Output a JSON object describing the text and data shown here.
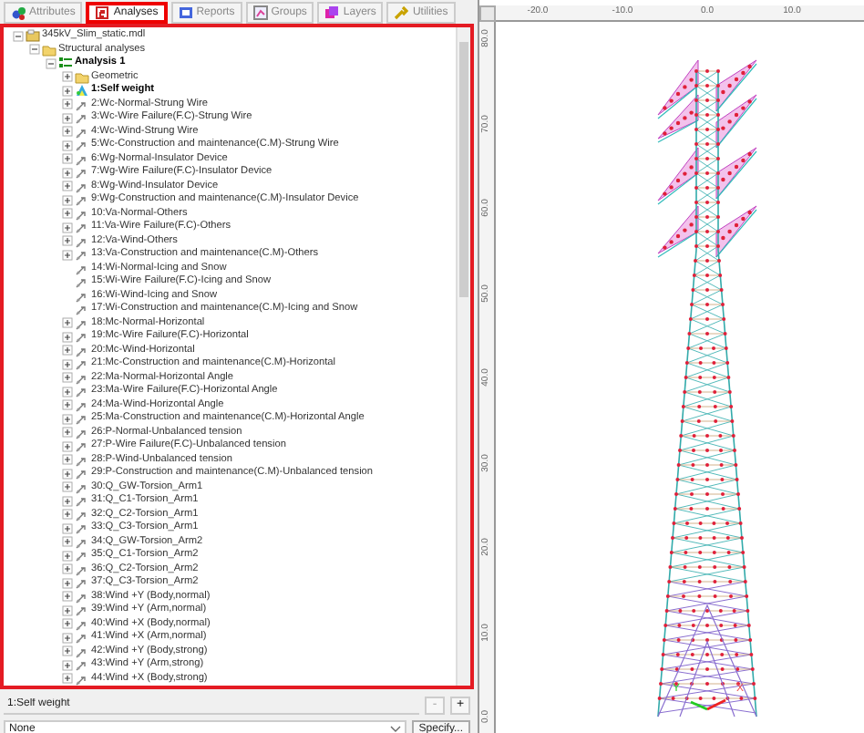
{
  "tabs": [
    {
      "label": "Attributes",
      "selected": false
    },
    {
      "label": "Analyses",
      "selected": true
    },
    {
      "label": "Reports",
      "selected": false
    },
    {
      "label": "Groups",
      "selected": false
    },
    {
      "label": "Layers",
      "selected": false
    },
    {
      "label": "Utilities",
      "selected": false
    }
  ],
  "tree": [
    {
      "label": "345kV_Slim_static.mdl",
      "kind": "file",
      "expandable": true,
      "expanded": true,
      "children": [
        {
          "label": "Structural analyses",
          "kind": "folder",
          "expandable": true,
          "expanded": true,
          "children": [
            {
              "label": "Analysis 1",
              "kind": "analysis",
              "expandable": true,
              "expanded": true,
              "children": [
                {
                  "label": "Geometric",
                  "kind": "folder",
                  "expandable": true,
                  "expanded": false
                },
                {
                  "label": "1:Self weight",
                  "kind": "active_load",
                  "expandable": true,
                  "expanded": false
                },
                {
                  "label": "2:Wc-Normal-Strung Wire",
                  "kind": "load",
                  "expandable": true,
                  "expanded": false
                },
                {
                  "label": "3:Wc-Wire Failure(F.C)-Strung Wire",
                  "kind": "load",
                  "expandable": true,
                  "expanded": false
                },
                {
                  "label": "4:Wc-Wind-Strung Wire",
                  "kind": "load",
                  "expandable": true,
                  "expanded": false
                },
                {
                  "label": "5:Wc-Construction and maintenance(C.M)-Strung Wire",
                  "kind": "load",
                  "expandable": true,
                  "expanded": false
                },
                {
                  "label": "6:Wg-Normal-Insulator Device",
                  "kind": "load",
                  "expandable": true,
                  "expanded": false
                },
                {
                  "label": "7:Wg-Wire Failure(F.C)-Insulator Device",
                  "kind": "load",
                  "expandable": true,
                  "expanded": false
                },
                {
                  "label": "8:Wg-Wind-Insulator Device",
                  "kind": "load",
                  "expandable": true,
                  "expanded": false
                },
                {
                  "label": "9:Wg-Construction and maintenance(C.M)-Insulator Device",
                  "kind": "load",
                  "expandable": true,
                  "expanded": false
                },
                {
                  "label": "10:Va-Normal-Others",
                  "kind": "load",
                  "expandable": true,
                  "expanded": false
                },
                {
                  "label": "11:Va-Wire Failure(F.C)-Others",
                  "kind": "load",
                  "expandable": true,
                  "expanded": false
                },
                {
                  "label": "12:Va-Wind-Others",
                  "kind": "load",
                  "expandable": true,
                  "expanded": false
                },
                {
                  "label": "13:Va-Construction and maintenance(C.M)-Others",
                  "kind": "load",
                  "expandable": true,
                  "expanded": false
                },
                {
                  "label": "14:Wi-Normal-Icing and Snow",
                  "kind": "load",
                  "expandable": false
                },
                {
                  "label": "15:Wi-Wire Failure(F.C)-Icing and Snow",
                  "kind": "load",
                  "expandable": false
                },
                {
                  "label": "16:Wi-Wind-Icing and Snow",
                  "kind": "load",
                  "expandable": false
                },
                {
                  "label": "17:Wi-Construction and maintenance(C.M)-Icing and Snow",
                  "kind": "load",
                  "expandable": false
                },
                {
                  "label": "18:Mc-Normal-Horizontal",
                  "kind": "load",
                  "expandable": true,
                  "expanded": false
                },
                {
                  "label": "19:Mc-Wire Failure(F.C)-Horizontal",
                  "kind": "load",
                  "expandable": true,
                  "expanded": false
                },
                {
                  "label": "20:Mc-Wind-Horizontal",
                  "kind": "load",
                  "expandable": true,
                  "expanded": false
                },
                {
                  "label": "21:Mc-Construction and maintenance(C.M)-Horizontal",
                  "kind": "load",
                  "expandable": true,
                  "expanded": false
                },
                {
                  "label": "22:Ma-Normal-Horizontal Angle",
                  "kind": "load",
                  "expandable": true,
                  "expanded": false
                },
                {
                  "label": "23:Ma-Wire Failure(F.C)-Horizontal Angle",
                  "kind": "load",
                  "expandable": true,
                  "expanded": false
                },
                {
                  "label": "24:Ma-Wind-Horizontal Angle",
                  "kind": "load",
                  "expandable": true,
                  "expanded": false
                },
                {
                  "label": "25:Ma-Construction and maintenance(C.M)-Horizontal Angle",
                  "kind": "load",
                  "expandable": true,
                  "expanded": false
                },
                {
                  "label": "26:P-Normal-Unbalanced tension",
                  "kind": "load",
                  "expandable": true,
                  "expanded": false
                },
                {
                  "label": "27:P-Wire Failure(F.C)-Unbalanced tension",
                  "kind": "load",
                  "expandable": true,
                  "expanded": false
                },
                {
                  "label": "28:P-Wind-Unbalanced tension",
                  "kind": "load",
                  "expandable": true,
                  "expanded": false
                },
                {
                  "label": "29:P-Construction and maintenance(C.M)-Unbalanced tension",
                  "kind": "load",
                  "expandable": true,
                  "expanded": false
                },
                {
                  "label": "30:Q_GW-Torsion_Arm1",
                  "kind": "load",
                  "expandable": true,
                  "expanded": false
                },
                {
                  "label": "31:Q_C1-Torsion_Arm1",
                  "kind": "load",
                  "expandable": true,
                  "expanded": false
                },
                {
                  "label": "32:Q_C2-Torsion_Arm1",
                  "kind": "load",
                  "expandable": true,
                  "expanded": false
                },
                {
                  "label": "33:Q_C3-Torsion_Arm1",
                  "kind": "load",
                  "expandable": true,
                  "expanded": false
                },
                {
                  "label": "34:Q_GW-Torsion_Arm2",
                  "kind": "load",
                  "expandable": true,
                  "expanded": false
                },
                {
                  "label": "35:Q_C1-Torsion_Arm2",
                  "kind": "load",
                  "expandable": true,
                  "expanded": false
                },
                {
                  "label": "36:Q_C2-Torsion_Arm2",
                  "kind": "load",
                  "expandable": true,
                  "expanded": false
                },
                {
                  "label": "37:Q_C3-Torsion_Arm2",
                  "kind": "load",
                  "expandable": true,
                  "expanded": false
                },
                {
                  "label": "38:Wind +Y (Body,normal)",
                  "kind": "load",
                  "expandable": true,
                  "expanded": false
                },
                {
                  "label": "39:Wind +Y (Arm,normal)",
                  "kind": "load",
                  "expandable": true,
                  "expanded": false
                },
                {
                  "label": "40:Wind +X (Body,normal)",
                  "kind": "load",
                  "expandable": true,
                  "expanded": false
                },
                {
                  "label": "41:Wind +X (Arm,normal)",
                  "kind": "load",
                  "expandable": true,
                  "expanded": false
                },
                {
                  "label": "42:Wind +Y (Body,strong)",
                  "kind": "load",
                  "expandable": true,
                  "expanded": false
                },
                {
                  "label": "43:Wind +Y (Arm,strong)",
                  "kind": "load",
                  "expandable": true,
                  "expanded": false
                },
                {
                  "label": "44:Wind +X (Body,strong)",
                  "kind": "load",
                  "expandable": true,
                  "expanded": false
                }
              ]
            }
          ]
        }
      ]
    }
  ],
  "current_case": {
    "value": "1:Self weight",
    "buttons": [
      {
        "label": "-",
        "disabled": true
      },
      {
        "label": "+",
        "disabled": false
      }
    ]
  },
  "filter": {
    "value": "None",
    "button": "Specify..."
  },
  "viewer": {
    "x_ruler": [
      "-20.0",
      "-10.0",
      "0.0",
      "10.0"
    ],
    "y_ruler": [
      "80.0",
      "70.0",
      "60.0",
      "50.0",
      "40.0",
      "30.0",
      "20.0",
      "10.0",
      "0.0"
    ],
    "axes": [
      "Y",
      "X"
    ]
  }
}
